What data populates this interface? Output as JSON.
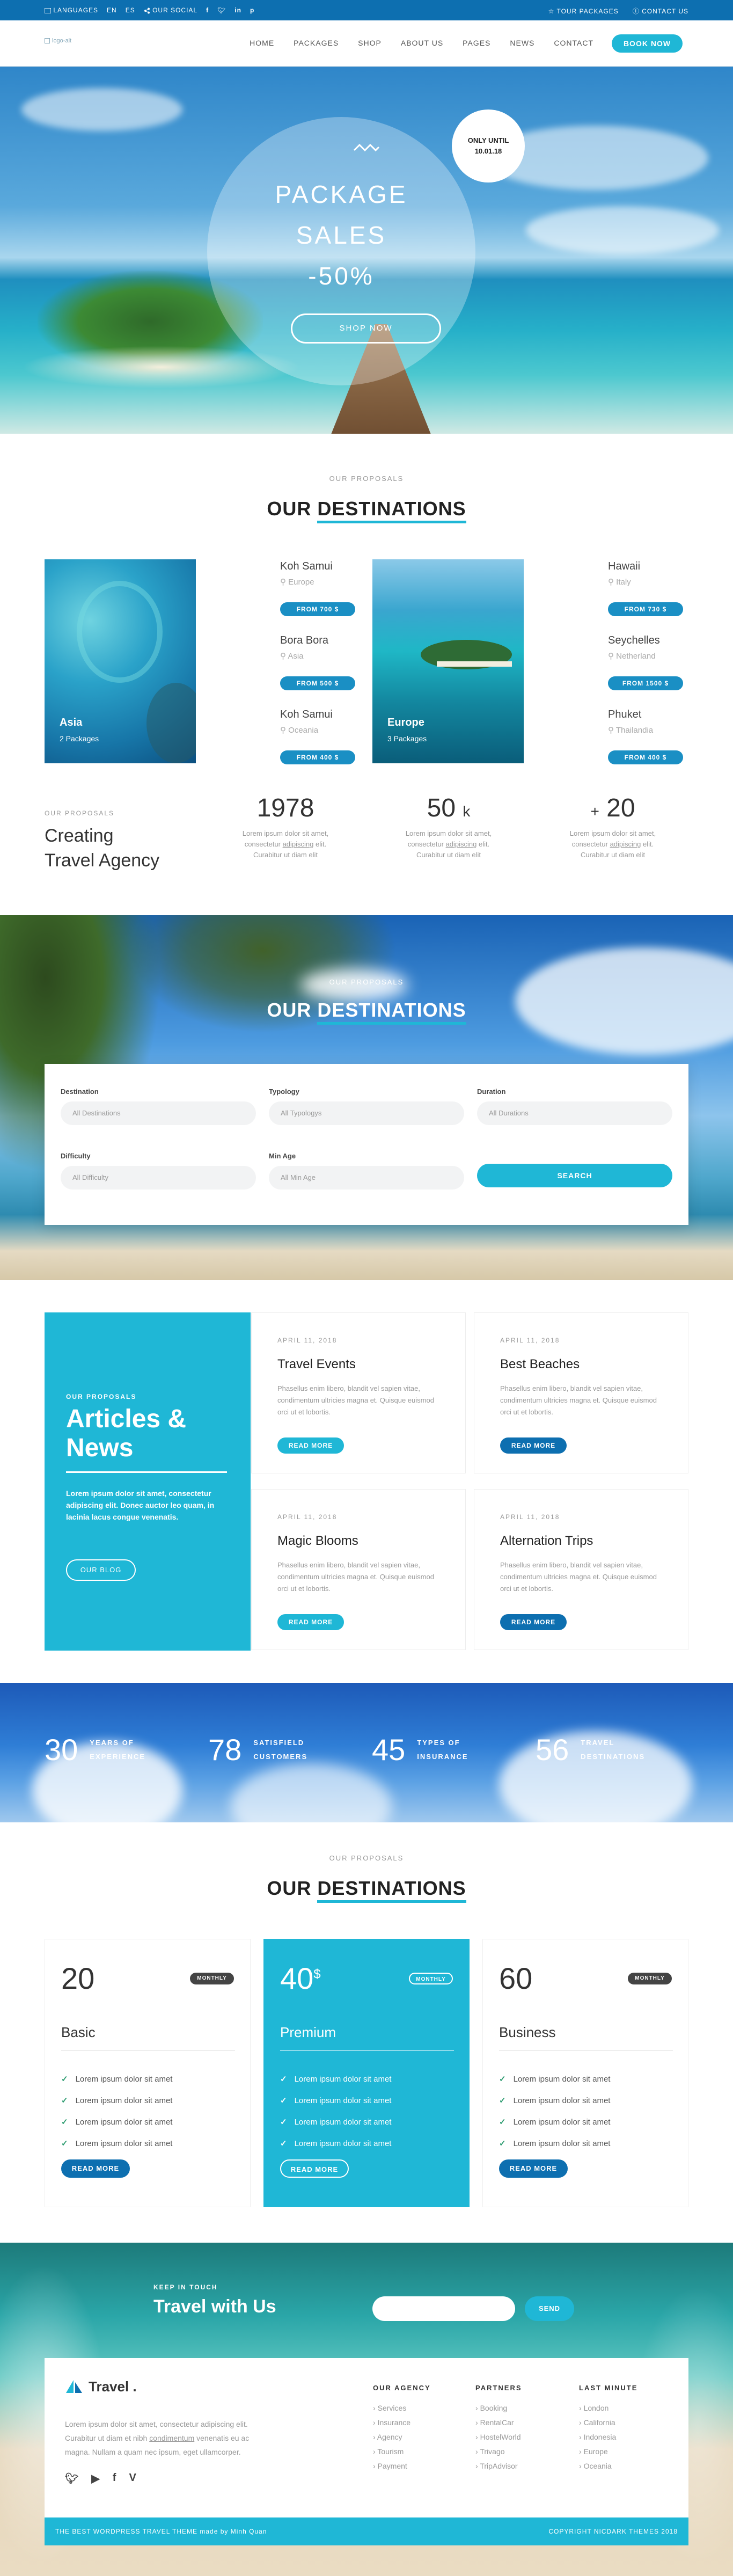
{
  "topbar": {
    "languages": "LANGUAGES",
    "lang_en": "EN",
    "lang_es": "ES",
    "our_social": "OUR SOCIAL",
    "tour_packages": "TOUR PACKAGES",
    "contact_us": "CONTACT US"
  },
  "nav": {
    "logo_alt": "logo-alt",
    "items": [
      "HOME",
      "PACKAGES",
      "SHOP",
      "ABOUT US",
      "PAGES",
      "NEWS",
      "CONTACT"
    ],
    "book_now": "BOOK NOW"
  },
  "hero": {
    "badge_line1": "ONLY UNTIL",
    "badge_line2": "10.01.18",
    "title_1": "PACKAGE",
    "title_2": "SALES",
    "title_3": "-50%",
    "button": "SHOP NOW"
  },
  "proposals1": {
    "pre": "OUR PROPOSALS",
    "title_a": "OUR",
    "title_b": "DESTINATIONS"
  },
  "destinations": {
    "asia": {
      "name": "Asia",
      "count": "2 Packages"
    },
    "europe": {
      "name": "Europe",
      "count": "3 Packages"
    },
    "places": [
      {
        "name": "Koh Samui",
        "country": "Europe",
        "price": "FROM 700 $"
      },
      {
        "name": "Bora Bora",
        "country": "Asia",
        "price": "FROM 500 $"
      },
      {
        "name": "Koh Samui",
        "country": "Oceania",
        "price": "FROM 400 $"
      },
      {
        "name": "Hawaii",
        "country": "Italy",
        "price": "FROM 730 $"
      },
      {
        "name": "Seychelles",
        "country": "Netherland",
        "price": "FROM 1500 $"
      },
      {
        "name": "Phuket",
        "country": "Thailandia",
        "price": "FROM 400 $"
      }
    ]
  },
  "agency": {
    "pre": "OUR PROPOSALS",
    "title_1": "Creating",
    "title_2": "Travel Agency",
    "stats": [
      {
        "value": "1978",
        "unit": "",
        "prefix": "",
        "text_1": "Lorem ipsum dolor sit amet,",
        "text_2a": "consectetur ",
        "text_link": "adipiscing",
        "text_2b": " elit.",
        "text_3": "Curabitur ut diam elit"
      },
      {
        "value": "50",
        "unit": "k",
        "prefix": "",
        "text_1": "Lorem ipsum dolor sit amet,",
        "text_2a": "consectetur ",
        "text_link": "adipiscing",
        "text_2b": " elit.",
        "text_3": "Curabitur ut diam elit"
      },
      {
        "value": "20",
        "unit": "",
        "prefix": "+",
        "text_1": "Lorem ipsum dolor sit amet,",
        "text_2a": "consectetur ",
        "text_link": "adipiscing",
        "text_2b": " elit.",
        "text_3": "Curabitur ut diam elit"
      }
    ]
  },
  "search": {
    "pre": "OUR PROPOSALS",
    "title_a": "OUR",
    "title_b": "DESTINATIONS",
    "destination_label": "Destination",
    "destination_value": "All Destinations",
    "typology_label": "Typology",
    "typology_value": "All Typologys",
    "duration_label": "Duration",
    "duration_value": "All Durations",
    "difficulty_label": "Difficulty",
    "difficulty_value": "All Difficulty",
    "minage_label": "Min Age",
    "minage_value": "All Min Age",
    "button": "SEARCH"
  },
  "articles": {
    "pre": "OUR PROPOSALS",
    "title_1": "Articles &",
    "title_2": "News",
    "text": "Lorem ipsum dolor sit amet, consectetur adipiscing elit. Donec auctor leo quam, in lacinia lacus congue venenatis.",
    "blog_button": "OUR BLOG",
    "items": [
      {
        "date": "APRIL 11, 2018",
        "title": "Travel Events",
        "text": "Phasellus enim libero, blandit vel sapien vitae, condimentum ultricies magna et. Quisque euismod orci ut et lobortis.",
        "button": "READ MORE"
      },
      {
        "date": "APRIL 11, 2018",
        "title": "Best Beaches",
        "text": "Phasellus enim libero, blandit vel sapien vitae, condimentum ultricies magna et. Quisque euismod orci ut et lobortis.",
        "button": "READ MORE"
      },
      {
        "date": "APRIL 11, 2018",
        "title": "Magic Blooms",
        "text": "Phasellus enim libero, blandit vel sapien vitae, condimentum ultricies magna et. Quisque euismod orci ut et lobortis.",
        "button": "READ MORE"
      },
      {
        "date": "APRIL 11, 2018",
        "title": "Alternation Trips",
        "text": "Phasellus enim libero, blandit vel sapien vitae, condimentum ultricies magna et. Quisque euismod orci ut et lobortis.",
        "button": "READ MORE"
      }
    ]
  },
  "counters": [
    {
      "value": "30",
      "line1": "YEARS OF",
      "line2": "EXPERIENCE"
    },
    {
      "value": "78",
      "line1": "SATISFIELD",
      "line2": "CUSTOMERS"
    },
    {
      "value": "45",
      "line1": "TYPES OF",
      "line2": "INSURANCE"
    },
    {
      "value": "56",
      "line1": "TRAVEL",
      "line2": "DESTINATIONS"
    }
  ],
  "pricing": {
    "pre": "OUR PROPOSALS",
    "title_a": "OUR",
    "title_b": "DESTINATIONS",
    "plans": [
      {
        "value": "20",
        "currency": "",
        "period": "MONTHLY",
        "name": "Basic",
        "features": [
          "Lorem ipsum dolor sit amet",
          "Lorem ipsum dolor sit amet",
          "Lorem ipsum dolor sit amet",
          "Lorem ipsum dolor sit amet"
        ],
        "button": "READ MORE"
      },
      {
        "value": "40",
        "currency": "$",
        "period": "MONTHLY",
        "name": "Premium",
        "features": [
          "Lorem ipsum dolor sit amet",
          "Lorem ipsum dolor sit amet",
          "Lorem ipsum dolor sit amet",
          "Lorem ipsum dolor sit amet"
        ],
        "button": "READ MORE"
      },
      {
        "value": "60",
        "currency": "",
        "period": "MONTHLY",
        "name": "Business",
        "features": [
          "Lorem ipsum dolor sit amet",
          "Lorem ipsum dolor sit amet",
          "Lorem ipsum dolor sit amet",
          "Lorem ipsum dolor sit amet"
        ],
        "button": "READ MORE"
      }
    ]
  },
  "newsletter": {
    "pre": "KEEP IN TOUCH",
    "title": "Travel with Us",
    "button": "SEND"
  },
  "footer": {
    "brand": "Travel .",
    "text_1": "Lorem ipsum dolor sit amet, consectetur adipiscing elit.",
    "text_2a": "Curabitur ut diam et nibh ",
    "text_link": "condimentum",
    "text_2b": " venenatis eu ac",
    "text_3": "magna. Nullam a quam nec ipsum, eget ullamcorper.",
    "columns": [
      {
        "title": "OUR AGENCY",
        "items": [
          "Services",
          "Insurance",
          "Agency",
          "Tourism",
          "Payment"
        ]
      },
      {
        "title": "PARTNERS",
        "items": [
          "Booking",
          "RentalCar",
          "HostelWorld",
          "Trivago",
          "TripAdvisor"
        ]
      },
      {
        "title": "LAST MINUTE",
        "items": [
          "London",
          "California",
          "Indonesia",
          "Europe",
          "Oceania"
        ]
      }
    ],
    "bottom_left": "THE BEST WORDPRESS TRAVEL THEME made by Minh Quan",
    "bottom_right": "COPYRIGHT NICDARK THEMES 2018"
  },
  "colors": {
    "primary": "#1fb7d6",
    "dark_blue": "#0d6fb0"
  }
}
